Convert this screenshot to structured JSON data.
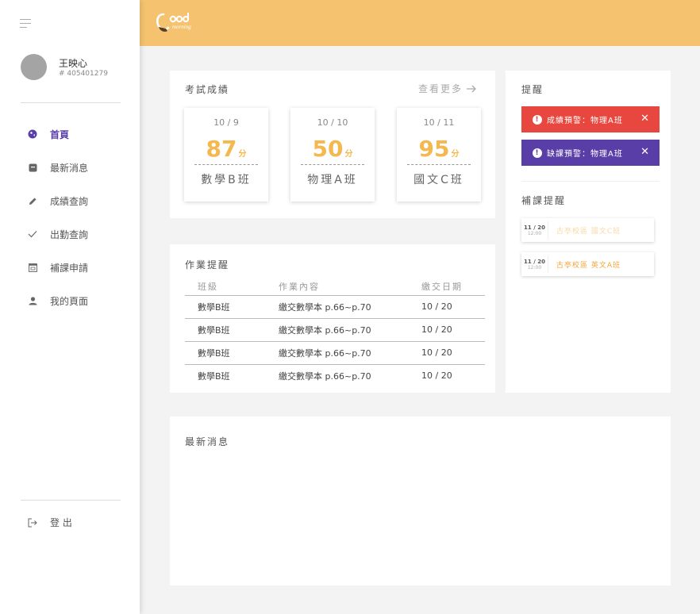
{
  "sidebar": {
    "user": {
      "name": "王映心",
      "id": "# 405401279"
    },
    "items": [
      {
        "label": "首頁",
        "icon": "globe-icon",
        "active": true
      },
      {
        "label": "最新消息",
        "icon": "message-icon"
      },
      {
        "label": "成績查詢",
        "icon": "pencil-icon"
      },
      {
        "label": "出勤查詢",
        "icon": "check-icon"
      },
      {
        "label": "補課申請",
        "icon": "calendar-icon"
      },
      {
        "label": "我的頁面",
        "icon": "person-icon"
      }
    ],
    "logout": "登 出"
  },
  "header": {
    "logo_text": "Good morning"
  },
  "exam": {
    "title": "考試成績",
    "more": "查看更多",
    "scores": [
      {
        "date": "10 / 9",
        "value": "87",
        "unit": "分",
        "subject": "數學B班"
      },
      {
        "date": "10 / 10",
        "value": "50",
        "unit": "分",
        "subject": "物理A班"
      },
      {
        "date": "10 / 11",
        "value": "95",
        "unit": "分",
        "subject": "國文C班"
      }
    ]
  },
  "homework": {
    "title": "作業提醒",
    "headers": [
      "班級",
      "作業內容",
      "繳交日期"
    ],
    "rows": [
      [
        "數學B班",
        "繳交數學本 p.66~p.70",
        "10 / 20"
      ],
      [
        "數學B班",
        "繳交數學本 p.66~p.70",
        "10 / 20"
      ],
      [
        "數學B班",
        "繳交數學本 p.66~p.70",
        "10 / 20"
      ],
      [
        "數學B班",
        "繳交數學本 p.66~p.70",
        "10 / 20"
      ]
    ]
  },
  "alerts": {
    "title": "提醒",
    "items": [
      {
        "text": "成績預警：物理A班",
        "color": "#e8473f"
      },
      {
        "text": "缺課預警：物理A班",
        "color": "#5a3ea7"
      }
    ],
    "makeup_title": "補課提醒",
    "makeup": [
      {
        "date": "11 / 20",
        "time": "12:00",
        "text": "古亭校區 國文C班"
      },
      {
        "date": "11 / 20",
        "time": "12:00",
        "text": "古亭校區 英文A班"
      }
    ]
  },
  "news": {
    "title": "最新消息"
  },
  "colors": {
    "accent": "#f5c36f",
    "brand": "#5a3ea7",
    "danger": "#e8473f",
    "score": "#f5b84e"
  }
}
